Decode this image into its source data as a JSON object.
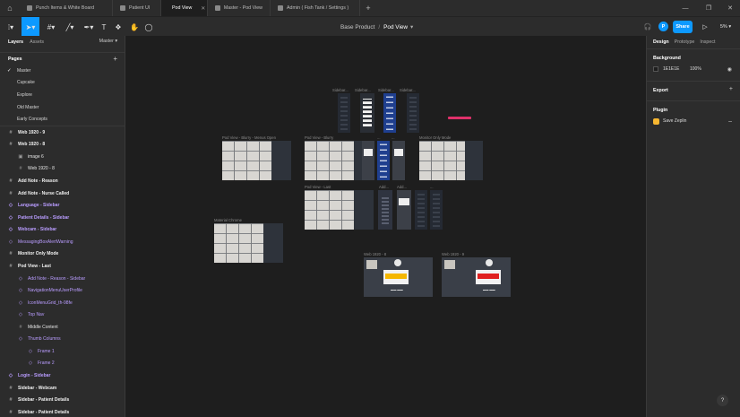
{
  "tabs": [
    {
      "label": "Punch Items & White Board",
      "active": false
    },
    {
      "label": "Patient UI",
      "active": false
    },
    {
      "label": "Pod View",
      "active": true
    },
    {
      "label": "Master - Pod View",
      "active": false
    },
    {
      "label": "Admin ( Fish Tank / Settings )",
      "active": false
    }
  ],
  "toolbar": {
    "project": "Base Product",
    "separator": "/",
    "file": "Pod View",
    "avatar_initial": "P",
    "share_label": "Share",
    "zoom": "5%"
  },
  "left_panel": {
    "tab_layers": "Layers",
    "tab_assets": "Assets",
    "current_page": "Master",
    "pages_title": "Pages",
    "pages": [
      "Master",
      "Cupcake",
      "Explore",
      "Old Master",
      "Early Concepts"
    ],
    "layers": [
      {
        "label": "Web 1920 - 9",
        "indent": 0,
        "kind": "frame",
        "bold": true
      },
      {
        "label": "Web 1920 - 8",
        "indent": 0,
        "kind": "frame",
        "bold": true
      },
      {
        "label": "image 6",
        "indent": 1,
        "kind": "image",
        "bold": false
      },
      {
        "label": "Web 1920 - 8",
        "indent": 1,
        "kind": "frame",
        "bold": false
      },
      {
        "label": "Add Note - Reason",
        "indent": 0,
        "kind": "frame",
        "bold": true
      },
      {
        "label": "Add Note - Nurse Called",
        "indent": 0,
        "kind": "frame",
        "bold": true
      },
      {
        "label": "Language - Sidebar",
        "indent": 0,
        "kind": "component",
        "bold": true
      },
      {
        "label": "Patient Details - Sidebar",
        "indent": 0,
        "kind": "component",
        "bold": true
      },
      {
        "label": "Webcam - Sidebar",
        "indent": 0,
        "kind": "component",
        "bold": true
      },
      {
        "label": "MessagingBoxAlertWarning",
        "indent": 0,
        "kind": "component",
        "bold": false
      },
      {
        "label": "Monitor Only Mode",
        "indent": 0,
        "kind": "frame",
        "bold": true
      },
      {
        "label": "Pod View - Last",
        "indent": 0,
        "kind": "frame",
        "bold": true
      },
      {
        "label": "Add Note - Reason - Sidebar",
        "indent": 1,
        "kind": "component",
        "bold": false
      },
      {
        "label": "NavigationMenuUserProfile",
        "indent": 1,
        "kind": "component",
        "bold": false
      },
      {
        "label": "IconMenuGrid_th-98fe",
        "indent": 1,
        "kind": "component",
        "bold": false
      },
      {
        "label": "Top Nav",
        "indent": 1,
        "kind": "component",
        "bold": false
      },
      {
        "label": "Middle Content",
        "indent": 1,
        "kind": "frame",
        "bold": false
      },
      {
        "label": "Thumb Columns",
        "indent": 1,
        "kind": "component",
        "bold": false
      },
      {
        "label": "Frame 1",
        "indent": 2,
        "kind": "component",
        "bold": false
      },
      {
        "label": "Frame 2",
        "indent": 2,
        "kind": "component",
        "bold": false
      },
      {
        "label": "Login - Sidebar",
        "indent": 0,
        "kind": "component",
        "bold": true
      },
      {
        "label": "Sidebar - Webcam",
        "indent": 0,
        "kind": "frame",
        "bold": true
      },
      {
        "label": "Sidebar - Patient Details",
        "indent": 0,
        "kind": "frame",
        "bold": true
      },
      {
        "label": "Sidebar - Patient Details",
        "indent": 0,
        "kind": "frame",
        "bold": true
      }
    ]
  },
  "canvas": {
    "frames": [
      {
        "label": "Sidebar...",
        "style": "tall"
      },
      {
        "label": "Sidebar...",
        "style": "white"
      },
      {
        "label": "Sidebar...",
        "style": "blue"
      },
      {
        "label": "Sidebar...",
        "style": "tall"
      },
      {
        "label": "Pod View - Blurry - Menus Open",
        "style": "gal"
      },
      {
        "label": "Pod View - Blurry",
        "style": "gal"
      },
      {
        "label": "Pod View - Last",
        "style": "gal"
      },
      {
        "label": "Monitor Only Mode",
        "style": "gal"
      },
      {
        "label": "Material Chrome",
        "style": "gal"
      },
      {
        "label": "Web 1920 - 8",
        "style": "web"
      },
      {
        "label": "Web 1920 - 9",
        "style": "web"
      }
    ],
    "small_frame_labels": [
      "...",
      "...",
      "Add...",
      "Add...",
      "..."
    ]
  },
  "right_panel": {
    "tab_design": "Design",
    "tab_prototype": "Prototype",
    "tab_inspect": "Inspect",
    "background_title": "Background",
    "bg_hex": "1E1E1E",
    "bg_opacity": "100%",
    "export_title": "Export",
    "plugin_title": "Plugin",
    "plugin_name": "Save Zeplin"
  },
  "colors": {
    "accent": "#0d99ff",
    "component": "#b99cff",
    "panel": "#2c2c2c",
    "canvas": "#1e1e1e"
  },
  "help_label": "?"
}
